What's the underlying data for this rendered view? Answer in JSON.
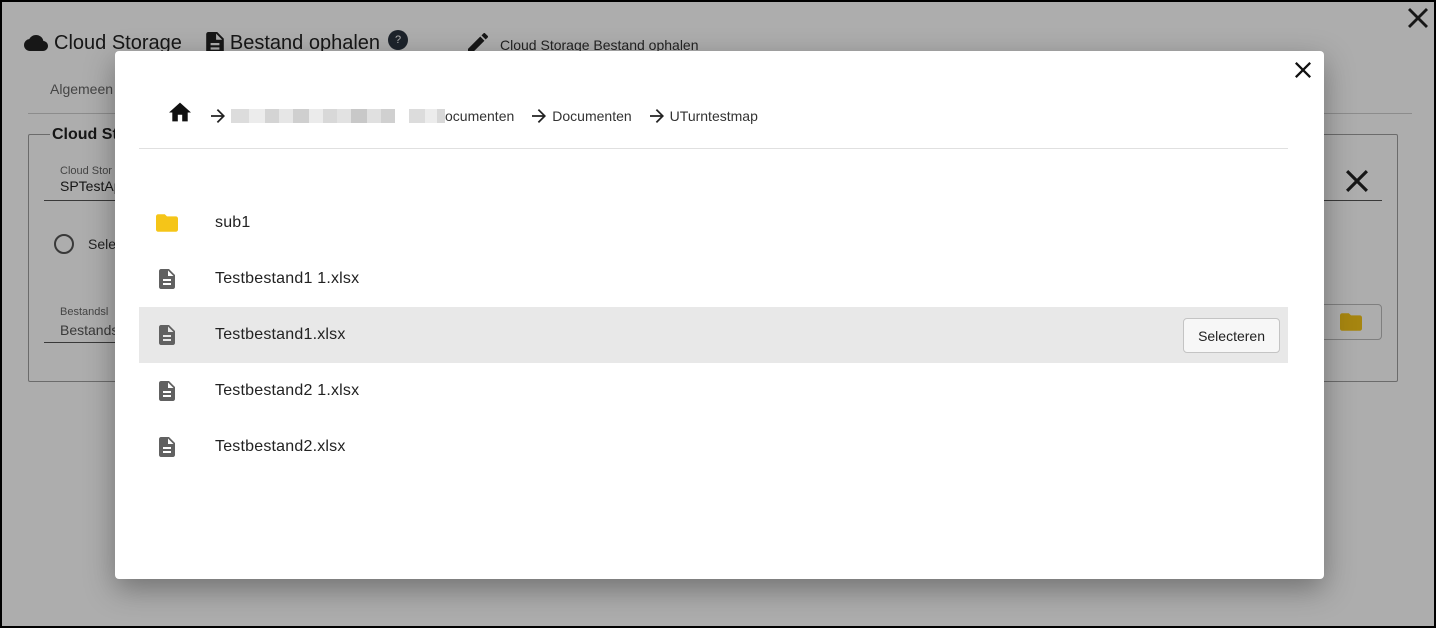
{
  "background": {
    "app_title": "Cloud Storage",
    "page_title": "Bestand ophalen",
    "help_badge": "?",
    "subtitle": "Cloud Storage Bestand ophalen",
    "tab_label": "Algemeen",
    "fieldset_legend": "Cloud St",
    "field1_label": "Cloud Stor",
    "field1_value": "SPTestAp",
    "radio_label": "Sele",
    "field2_label": "Bestandsl",
    "field2_value": "Bestands"
  },
  "modal": {
    "breadcrumb": [
      {
        "label": "ocumenten",
        "redacted_prefix": true
      },
      {
        "label": "Documenten"
      },
      {
        "label": "UTurntestmap"
      }
    ],
    "items": [
      {
        "name": "sub1",
        "type": "folder",
        "selected": false
      },
      {
        "name": "Testbestand1 1.xlsx",
        "type": "file",
        "selected": false
      },
      {
        "name": "Testbestand1.xlsx",
        "type": "file",
        "selected": true
      },
      {
        "name": "Testbestand2 1.xlsx",
        "type": "file",
        "selected": false
      },
      {
        "name": "Testbestand2.xlsx",
        "type": "file",
        "selected": false
      }
    ],
    "select_label": "Selecteren"
  },
  "colors": {
    "folder": "#f5c518",
    "file_icon": "#616161",
    "selected_row": "#e8e8e8",
    "help_badge": "#2b3440"
  },
  "icons": {
    "home": "home-icon",
    "folder": "folder-icon",
    "file": "file-icon",
    "arrow": "arrow-right-icon",
    "close": "close-icon",
    "cloud": "cloud-icon",
    "document": "document-icon",
    "edit": "pencil-icon"
  }
}
